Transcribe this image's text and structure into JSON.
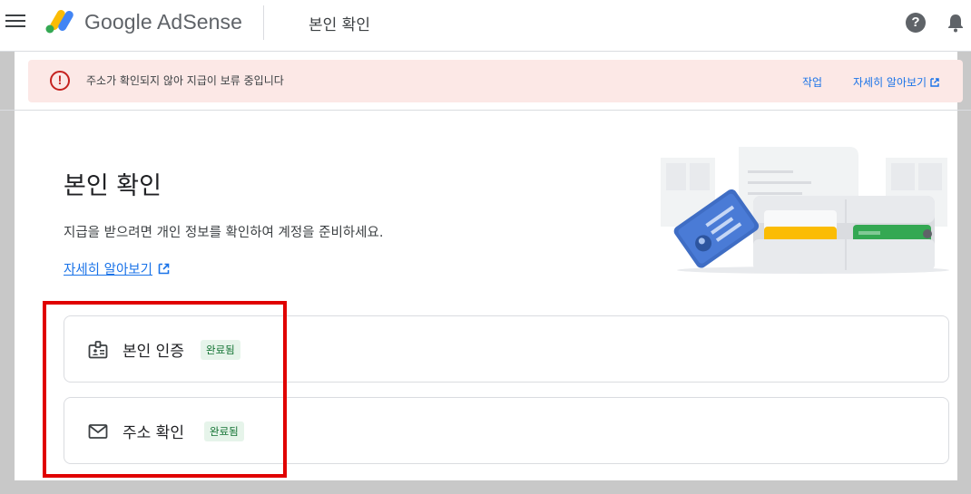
{
  "header": {
    "logo_text": "Google AdSense",
    "page_title": "본인 확인",
    "icons": [
      "menu-icon",
      "adsense-logo",
      "help-icon",
      "bell-icon"
    ]
  },
  "alert": {
    "message": "주소가 확인되지 않아 지급이 보류 중입니다",
    "action_label": "작업",
    "learn_more_label": "자세히 알아보기",
    "color": "#fce8e6"
  },
  "main": {
    "title": "본인 확인",
    "description": "지급을 받으려면 개인 정보를 확인하여 계정을 준비하세요.",
    "learn_more_label": "자세히 알아보기"
  },
  "cards": [
    {
      "label": "본인 인증",
      "status": "완료됨",
      "icon": "id-badge-icon"
    },
    {
      "label": "주소 확인",
      "status": "완료됨",
      "icon": "mail-icon"
    }
  ],
  "colors": {
    "accent": "#1a73e8",
    "success_bg": "#e6f4ea",
    "success_text": "#137333",
    "error": "#c5221f",
    "highlight_box": "#e00000"
  }
}
